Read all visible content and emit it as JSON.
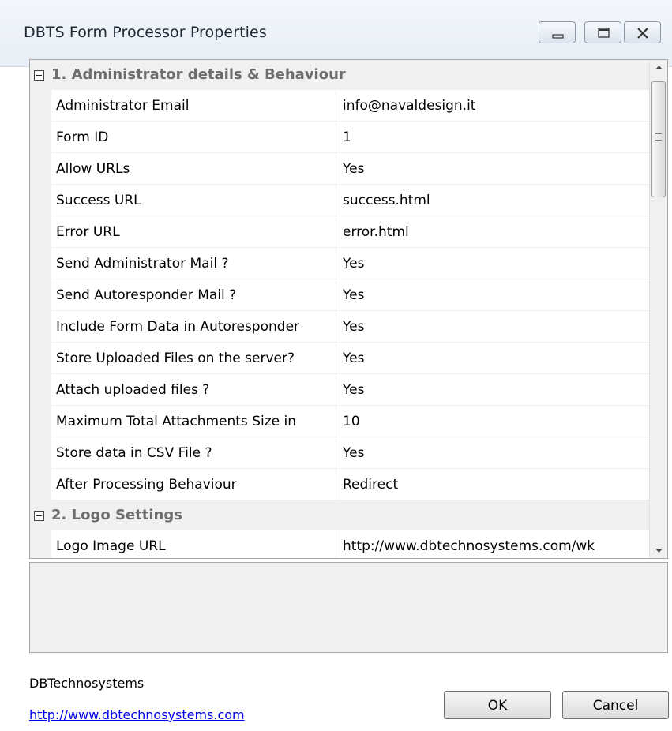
{
  "window": {
    "title": "DBTS Form Processor Properties"
  },
  "icons": {
    "minimize": "minimize-icon",
    "maximize": "maximize-icon",
    "close": "close-icon",
    "collapse": "collapse-minus-icon",
    "scroll_up": "scroll-up-arrow-icon",
    "scroll_down": "scroll-down-arrow-icon"
  },
  "categories": [
    {
      "label": "1. Administrator details & Behaviour",
      "properties": [
        {
          "name": "Administrator Email",
          "value": "info@navaldesign.it"
        },
        {
          "name": "Form ID",
          "value": "1"
        },
        {
          "name": "Allow URLs",
          "value": "Yes"
        },
        {
          "name": "Success URL",
          "value": "success.html"
        },
        {
          "name": "Error URL",
          "value": "error.html"
        },
        {
          "name": "Send Administrator Mail ?",
          "value": "Yes"
        },
        {
          "name": "Send Autoresponder Mail ?",
          "value": "Yes"
        },
        {
          "name": "Include Form Data in Autoresponder",
          "value": "Yes"
        },
        {
          "name": "Store Uploaded Files on the server?",
          "value": "Yes"
        },
        {
          "name": "Attach uploaded files ?",
          "value": "Yes"
        },
        {
          "name": "Maximum Total Attachments Size in",
          "value": "10"
        },
        {
          "name": "Store data in CSV File ?",
          "value": "Yes"
        },
        {
          "name": "After Processing Behaviour",
          "value": "Redirect"
        }
      ]
    },
    {
      "label": "2. Logo Settings",
      "properties": [
        {
          "name": "Logo Image URL",
          "value": "http://www.dbtechnosystems.com/wk"
        }
      ]
    }
  ],
  "footer": {
    "company": "DBTechnosystems",
    "link": "http://www.dbtechnosystems.com",
    "ok_label": "OK",
    "cancel_label": "Cancel"
  },
  "colors": {
    "category_bg": "#f0f0f0",
    "link": "#0000ee"
  }
}
